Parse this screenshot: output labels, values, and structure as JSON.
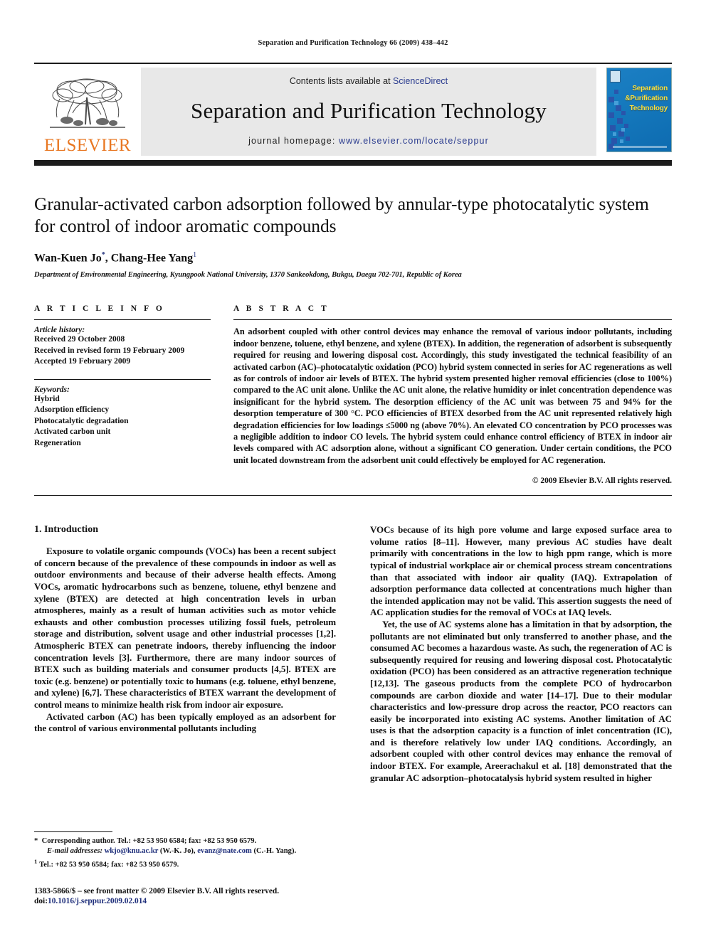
{
  "running_head": "Separation and Purification Technology 66 (2009) 438–442",
  "banner": {
    "contents_prefix": "Contents lists available at ",
    "sciencedirect": "ScienceDirect",
    "journal_name": "Separation and Purification Technology",
    "homepage_prefix": "journal homepage: ",
    "homepage_url": "www.elsevier.com/locate/seppur",
    "publisher_wordmark": "ELSEVIER",
    "publisher_logo_icon": "elsevier-tree-icon",
    "cover_title_line1": "Separation",
    "cover_title_line2": "&Purification",
    "cover_title_line3": "Technology",
    "link_color": "#2b3c8f",
    "wordmark_color": "#E87722",
    "banner_bg": "#e8e8e8",
    "cover_bg": "#1579bd",
    "cover_text_color": "#ffe13b"
  },
  "article": {
    "title": "Granular-activated carbon adsorption followed by annular-type photocatalytic system for control of indoor aromatic compounds",
    "author1": "Wan-Kuen Jo",
    "author1_mark": "*",
    "author2": "Chang-Hee Yang",
    "author2_mark": "1",
    "affiliation": "Department of Environmental Engineering, Kyungpook National University, 1370 Sankeokdong, Bukgu, Daegu 702-701, Republic of Korea"
  },
  "article_info": {
    "label": "A R T I C L E   I N F O",
    "history_label": "Article history:",
    "history": [
      "Received 29 October 2008",
      "Received in revised form 19 February 2009",
      "Accepted 19 February 2009"
    ],
    "keywords_label": "Keywords:",
    "keywords": [
      "Hybrid",
      "Adsorption efficiency",
      "Photocatalytic degradation",
      "Activated carbon unit",
      "Regeneration"
    ]
  },
  "abstract": {
    "label": "A B S T R A C T",
    "text": "An adsorbent coupled with other control devices may enhance the removal of various indoor pollutants, including indoor benzene, toluene, ethyl benzene, and xylene (BTEX). In addition, the regeneration of adsorbent is subsequently required for reusing and lowering disposal cost. Accordingly, this study investigated the technical feasibility of an activated carbon (AC)–photocatalytic oxidation (PCO) hybrid system connected in series for AC regenerations as well as for controls of indoor air levels of BTEX. The hybrid system presented higher removal efficiencies (close to 100%) compared to the AC unit alone. Unlike the AC unit alone, the relative humidity or inlet concentration dependence was insignificant for the hybrid system. The desorption efficiency of the AC unit was between 75 and 94% for the desorption temperature of 300 °C. PCO efficiencies of BTEX desorbed from the AC unit represented relatively high degradation efficiencies for low loadings ≤5000 ng (above 70%). An elevated CO concentration by PCO processes was a negligible addition to indoor CO levels. The hybrid system could enhance control efficiency of BTEX in indoor air levels compared with AC adsorption alone, without a significant CO generation. Under certain conditions, the PCO unit located downstream from the adsorbent unit could effectively be employed for AC regeneration.",
    "copyright": "© 2009 Elsevier B.V. All rights reserved."
  },
  "body": {
    "section_heading": "1. Introduction",
    "left_paragraphs": [
      "Exposure to volatile organic compounds (VOCs) has been a recent subject of concern because of the prevalence of these compounds in indoor as well as outdoor environments and because of their adverse health effects. Among VOCs, aromatic hydrocarbons such as benzene, toluene, ethyl benzene and xylene (BTEX) are detected at high concentration levels in urban atmospheres, mainly as a result of human activities such as motor vehicle exhausts and other combustion processes utilizing fossil fuels, petroleum storage and distribution, solvent usage and other industrial processes [1,2]. Atmospheric BTEX can penetrate indoors, thereby influencing the indoor concentration levels [3]. Furthermore, there are many indoor sources of BTEX such as building materials and consumer products [4,5]. BTEX are toxic (e.g. benzene) or potentially toxic to humans (e.g. toluene, ethyl benzene, and xylene) [6,7]. These characteristics of BTEX warrant the development of control means to minimize health risk from indoor air exposure.",
      "Activated carbon (AC) has been typically employed as an adsorbent for the control of various environmental pollutants including"
    ],
    "right_paragraphs": [
      "VOCs because of its high pore volume and large exposed surface area to volume ratios [8–11]. However, many previous AC studies have dealt primarily with concentrations in the low to high ppm range, which is more typical of industrial workplace air or chemical process stream concentrations than that associated with indoor air quality (IAQ). Extrapolation of adsorption performance data collected at concentrations much higher than the intended application may not be valid. This assertion suggests the need of AC application studies for the removal of VOCs at IAQ levels.",
      "Yet, the use of AC systems alone has a limitation in that by adsorption, the pollutants are not eliminated but only transferred to another phase, and the consumed AC becomes a hazardous waste. As such, the regeneration of AC is subsequently required for reusing and lowering disposal cost. Photocatalytic oxidation (PCO) has been considered as an attractive regeneration technique [12,13]. The gaseous products from the complete PCO of hydrocarbon compounds are carbon dioxide and water [14–17]. Due to their modular characteristics and low-pressure drop across the reactor, PCO reactors can easily be incorporated into existing AC systems. Another limitation of AC uses is that the adsorption capacity is a function of inlet concentration (IC), and is therefore relatively low under IAQ conditions. Accordingly, an adsorbent coupled with other control devices may enhance the removal of indoor BTEX. For example, Areerachakul et al. [18] demonstrated that the granular AC adsorption–photocatalysis hybrid system resulted in higher"
    ]
  },
  "footnotes": {
    "corresponding_mark": "*",
    "corresponding_text": "Corresponding author. Tel.: +82 53 950 6584; fax: +82 53 950 6579.",
    "email_label": "E-mail addresses:",
    "email1": "wkjo@knu.ac.kr",
    "email1_owner": "(W.-K. Jo),",
    "email2": "evanz@nate.com",
    "email2_owner": "(C.-H. Yang).",
    "note1_mark": "1",
    "note1_text": "Tel.: +82 53 950 6584; fax: +82 53 950 6579.",
    "issn_line": "1383-5866/$ – see front matter © 2009 Elsevier B.V. All rights reserved.",
    "doi_label": "doi:",
    "doi_value": "10.1016/j.seppur.2009.02.014"
  }
}
